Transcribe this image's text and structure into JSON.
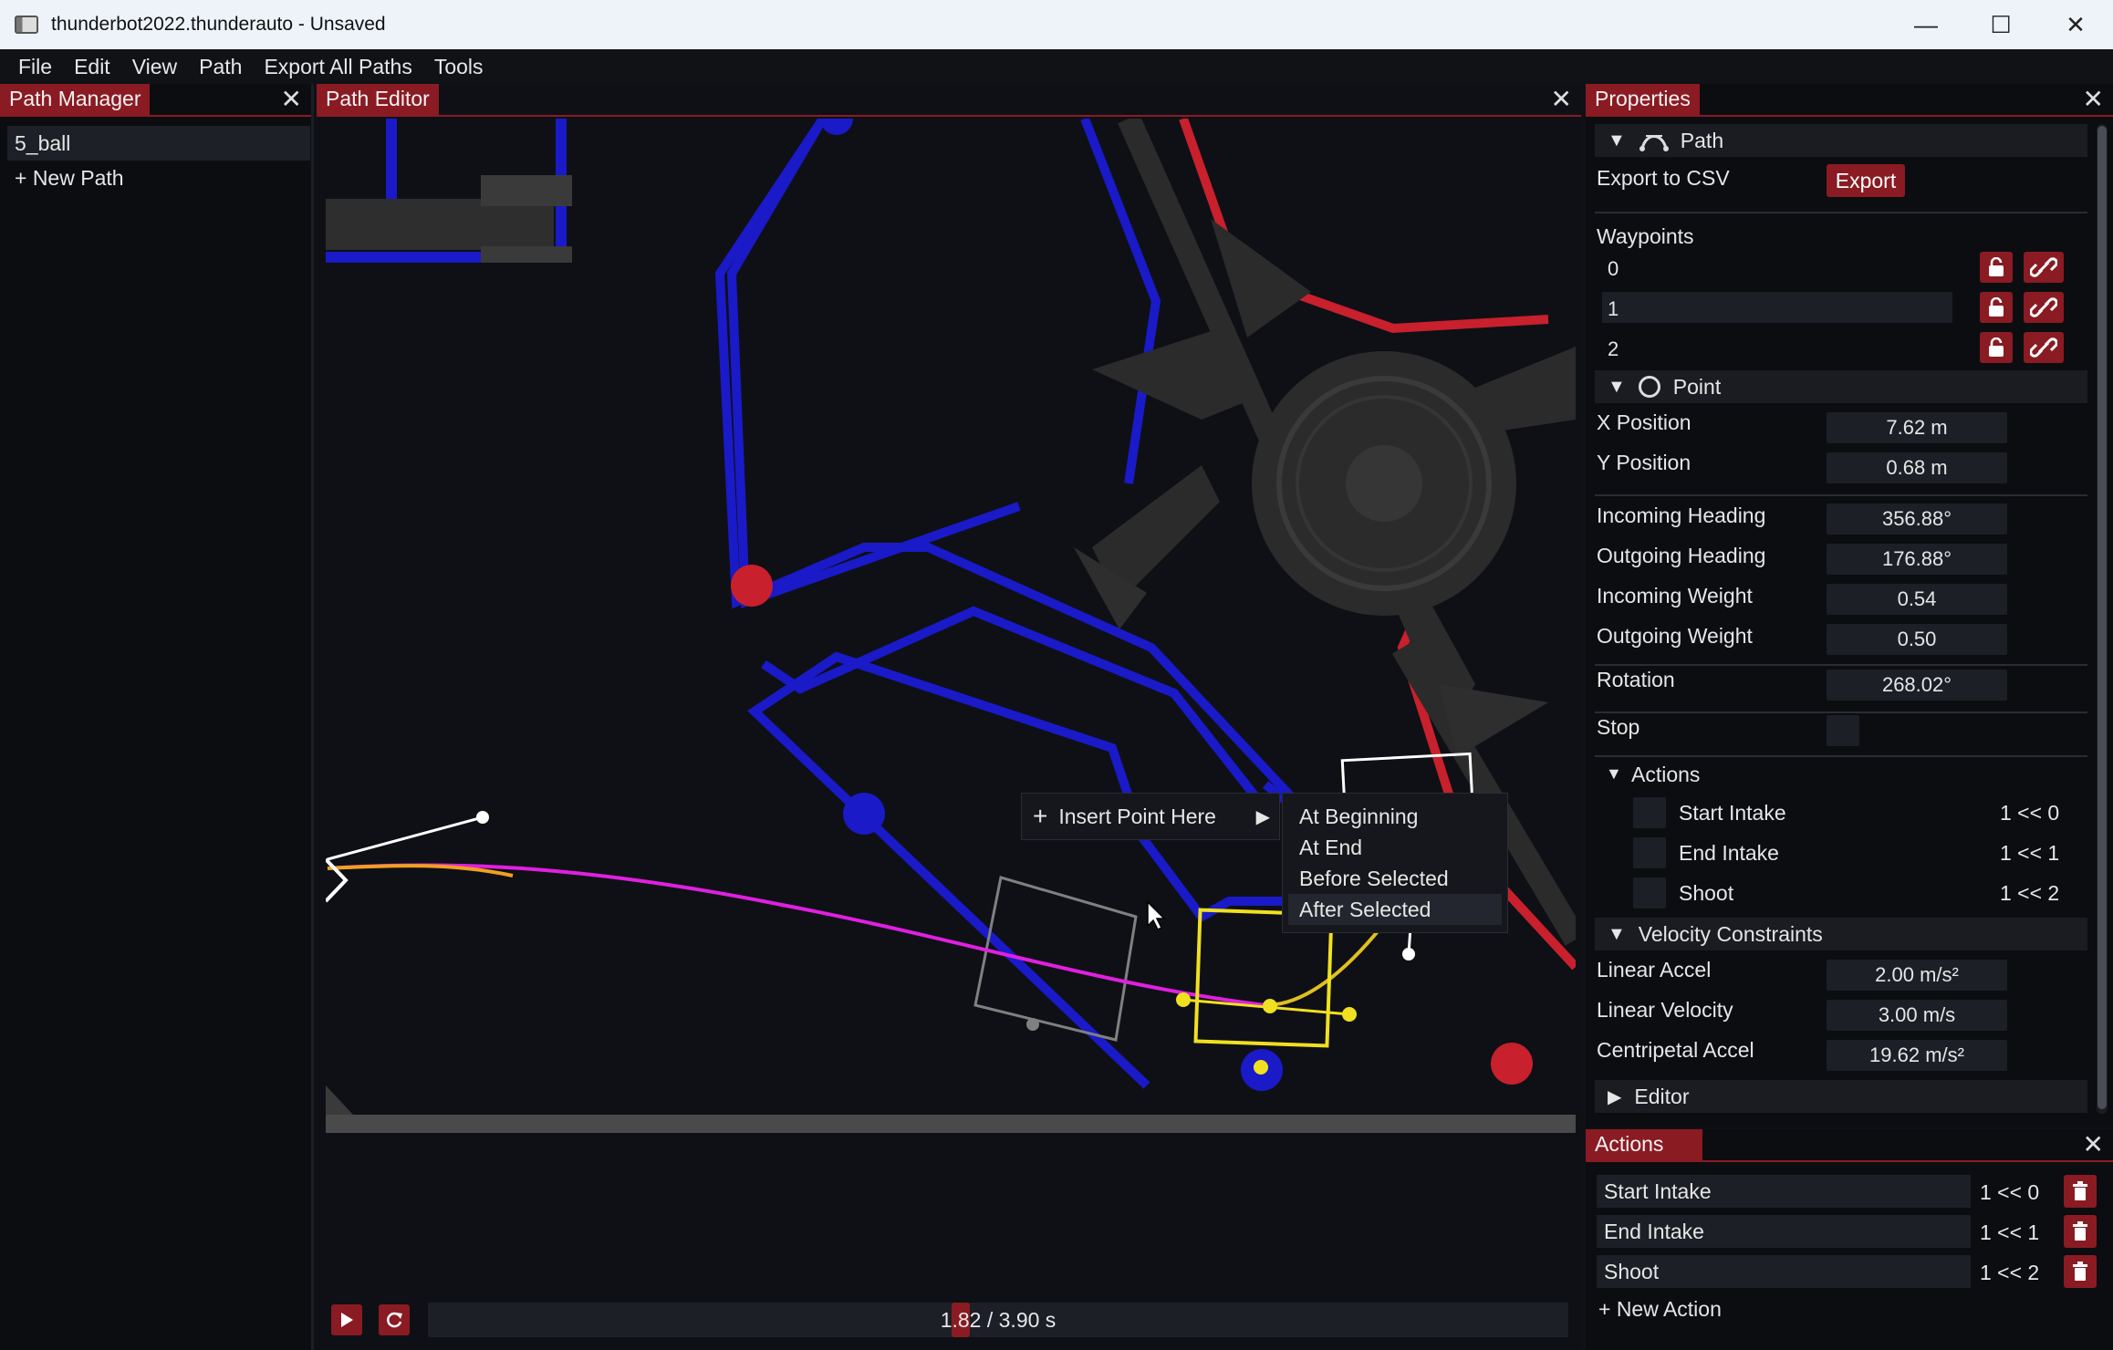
{
  "window": {
    "title": "thunderbot2022.thunderauto - Unsaved",
    "controls": {
      "minimize": "—",
      "maximize": "☐",
      "close": "✕"
    }
  },
  "menu": [
    "File",
    "Edit",
    "View",
    "Path",
    "Export All Paths",
    "Tools"
  ],
  "path_manager": {
    "title": "Path Manager",
    "paths": [
      "5_ball"
    ],
    "new_path": "+ New Path"
  },
  "path_editor": {
    "title": "Path Editor",
    "context_menu": {
      "insert_label": "Insert Point Here",
      "options": [
        "At Beginning",
        "At End",
        "Before Selected",
        "After Selected"
      ],
      "hovered": "After Selected"
    },
    "playback": {
      "time_label": "1.82 / 3.90 s",
      "current_time": 1.82,
      "total_time": 3.9
    }
  },
  "properties": {
    "title": "Properties",
    "path_section": "Path",
    "export_label": "Export to CSV",
    "export_button": "Export",
    "waypoints_label": "Waypoints",
    "waypoints": [
      "0",
      "1",
      "2"
    ],
    "selected_waypoint": "1",
    "point_section": "Point",
    "fields": {
      "x_position": {
        "label": "X Position",
        "value": "7.62 m"
      },
      "y_position": {
        "label": "Y Position",
        "value": "0.68 m"
      },
      "incoming_heading": {
        "label": "Incoming Heading",
        "value": "356.88°"
      },
      "outgoing_heading": {
        "label": "Outgoing Heading",
        "value": "176.88°"
      },
      "incoming_weight": {
        "label": "Incoming Weight",
        "value": "0.54"
      },
      "outgoing_weight": {
        "label": "Outgoing Weight",
        "value": "0.50"
      },
      "rotation": {
        "label": "Rotation",
        "value": "268.02°"
      },
      "stop": {
        "label": "Stop"
      }
    },
    "actions_section": "Actions",
    "actions": [
      {
        "name": "Start Intake",
        "bits": "1 << 0"
      },
      {
        "name": "End Intake",
        "bits": "1 << 1"
      },
      {
        "name": "Shoot",
        "bits": "1 << 2"
      }
    ],
    "velocity_section": "Velocity Constraints",
    "velocity": {
      "linear_accel": {
        "label": "Linear Accel",
        "value": "2.00 m/s²"
      },
      "linear_velocity": {
        "label": "Linear Velocity",
        "value": "3.00 m/s"
      },
      "centripetal_accel": {
        "label": "Centripetal Accel",
        "value": "19.62 m/s²"
      }
    },
    "editor_section": "Editor"
  },
  "actions_panel": {
    "title": "Actions",
    "items": [
      {
        "name": "Start Intake",
        "bits": "1 << 0"
      },
      {
        "name": "End Intake",
        "bits": "1 << 1"
      },
      {
        "name": "Shoot",
        "bits": "1 << 2"
      }
    ],
    "new_action": "+ New Action"
  },
  "colors": {
    "accent": "#8a1b23",
    "field_blue": "#1a1ac8",
    "field_red": "#c8202c",
    "path_magenta": "#e020e0",
    "waypoint_yellow": "#f0e020",
    "path_green": "#40d040"
  }
}
